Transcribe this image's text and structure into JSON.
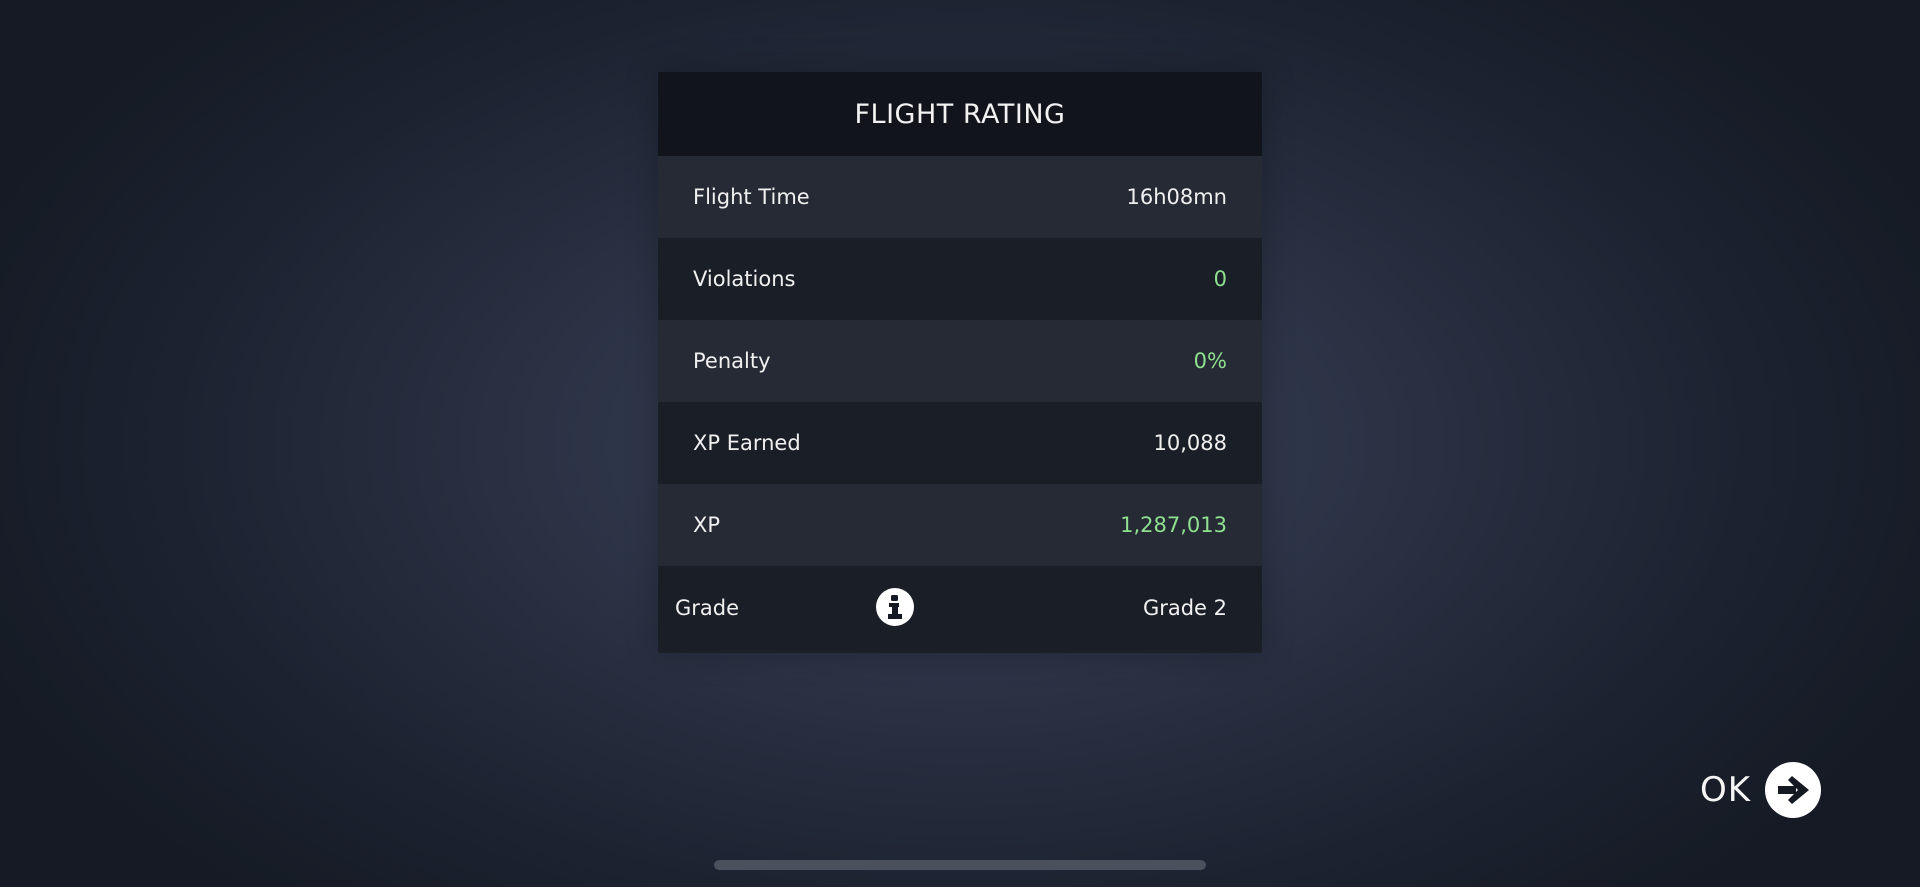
{
  "panel": {
    "title": "FLIGHT RATING",
    "rows": [
      {
        "label": "Flight Time",
        "value": "16h08mn"
      },
      {
        "label": "Violations",
        "value": "0"
      },
      {
        "label": "Penalty",
        "value": "0%"
      },
      {
        "label": "XP Earned",
        "value": "10,088"
      },
      {
        "label": "XP",
        "value": "1,287,013"
      }
    ],
    "grade": {
      "label": "Grade",
      "value": "Grade 2",
      "icon": "info-icon"
    }
  },
  "ok_button": {
    "label": "OK",
    "icon": "arrow-right-circle-icon"
  },
  "colors": {
    "positive": "#8fe08f",
    "header_bg": "#11141b",
    "row_light": "#252a35",
    "row_dark": "#1a1e27"
  }
}
